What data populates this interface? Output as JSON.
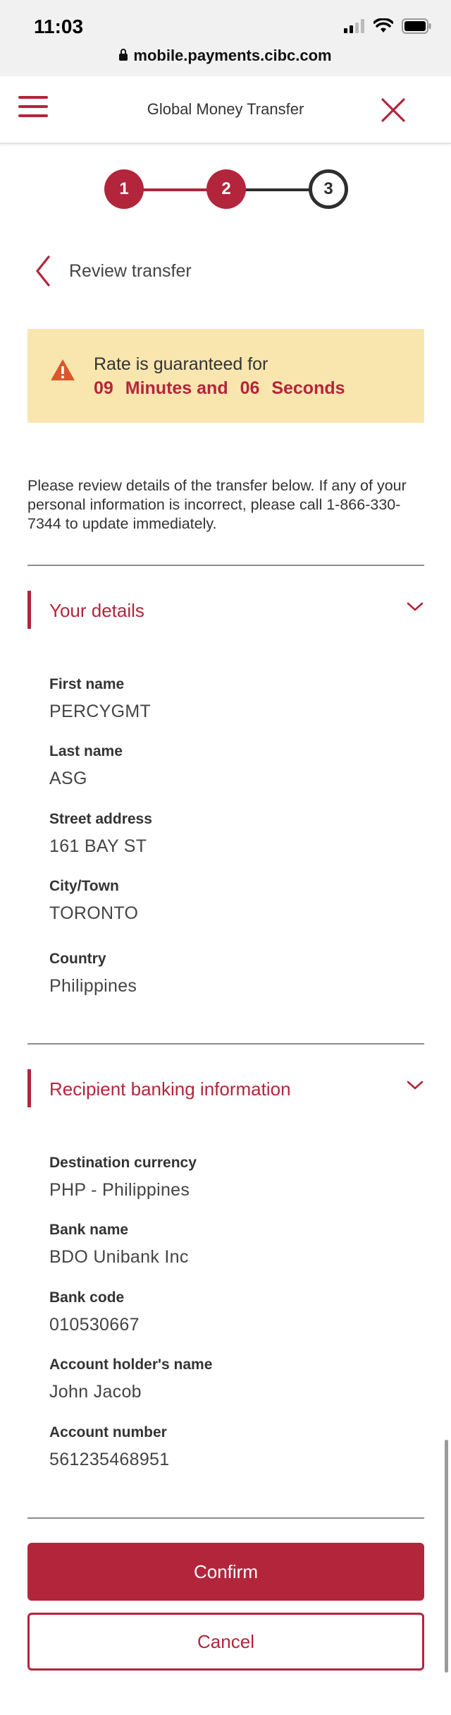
{
  "status_bar": {
    "time": "11:03",
    "url": "mobile.payments.cibc.com"
  },
  "header": {
    "title": "Global Money Transfer"
  },
  "stepper": {
    "steps": [
      "1",
      "2",
      "3"
    ],
    "current": 3
  },
  "back": {
    "label": "Review transfer"
  },
  "rate_banner": {
    "line1": "Rate is guaranteed for",
    "minutes": "09",
    "minutes_label": "Minutes and",
    "seconds": "06",
    "seconds_label": "Seconds"
  },
  "intro": "Please review details of the transfer below. If any of your personal information is incorrect, please call 1-866-330-7344 to update immediately.",
  "your_details": {
    "title": "Your details",
    "fields": [
      {
        "label": "First name",
        "value": "PERCYGMT"
      },
      {
        "label": "Last name",
        "value": "ASG"
      },
      {
        "label": "Street address",
        "value": "161 BAY ST"
      },
      {
        "label": "City/Town",
        "value": "TORONTO"
      },
      {
        "label": "Country",
        "value": "Philippines"
      }
    ]
  },
  "recipient": {
    "title": "Recipient banking information",
    "fields": [
      {
        "label": "Destination currency",
        "value": "PHP - Philippines"
      },
      {
        "label": "Bank name",
        "value": "BDO Unibank Inc"
      },
      {
        "label": "Bank code",
        "value": "010530667"
      },
      {
        "label": "Account holder's name",
        "value": "John Jacob"
      },
      {
        "label": "Account number",
        "value": "561235468951"
      }
    ]
  },
  "buttons": {
    "confirm": "Confirm",
    "cancel": "Cancel"
  },
  "colors": {
    "brand": "#b3253b",
    "banner_bg": "#f9e6ae",
    "warning": "#d9572b",
    "step_pending": "#2e2e2e"
  }
}
